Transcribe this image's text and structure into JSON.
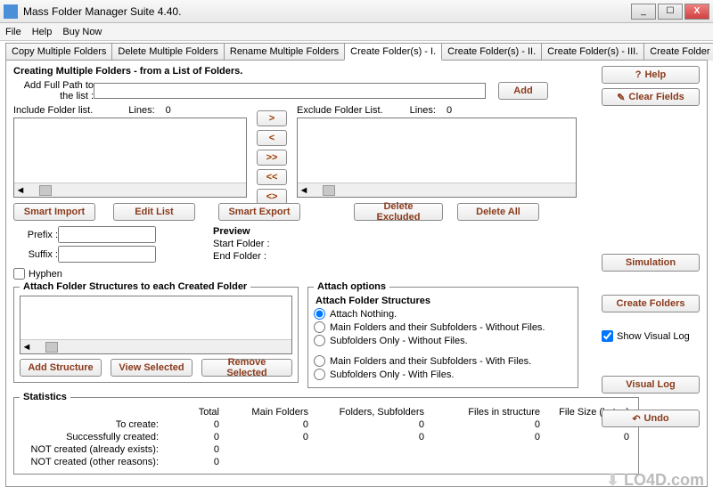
{
  "window": {
    "title": "Mass Folder Manager Suite 4.40."
  },
  "menu": {
    "file": "File",
    "help": "Help",
    "buy": "Buy Now"
  },
  "tabs": {
    "copy": "Copy Multiple Folders",
    "delete": "Delete Multiple Folders",
    "rename": "Rename Multiple Folders",
    "create1": "Create Folder(s)   - I.",
    "create2": "Create Folder(s)  - II.",
    "create3": "Create Folder(s)  - III.",
    "create4": "Create Folder -IV."
  },
  "header": {
    "title": "Creating Multiple Folders - from a List of Folders.",
    "pathLabel": "Add Full Path to\nthe list :",
    "pathValue": "",
    "add": "Add",
    "helpBtn": "Help",
    "clear": "Clear  Fields"
  },
  "lists": {
    "includeLabel": "Include Folder list.",
    "excludeLabel": "Exclude Folder List.",
    "linesLabel": "Lines:",
    "includeCount": "0",
    "excludeCount": "0"
  },
  "move": {
    "r": ">",
    "l": "<",
    "rr": ">>",
    "ll": "<<",
    "swap": "<>"
  },
  "listBtns": {
    "smartImport": "Smart Import",
    "editList": "Edit List",
    "smartExport": "Smart Export",
    "deleteExcluded": "Delete Excluded",
    "deleteAll": "Delete All"
  },
  "prefixSuffix": {
    "prefix": "Prefix :",
    "suffix": "Suffix :",
    "hyphen": "Hyphen"
  },
  "preview": {
    "label": "Preview",
    "start": "Start Folder :",
    "end": "End Folder :"
  },
  "attach": {
    "groupTitle": "Attach Folder Structures to each Created Folder",
    "addStructure": "Add Structure",
    "viewSelected": "View Selected",
    "removeSelected": "Remove Selected"
  },
  "options": {
    "groupTitle": "Attach options",
    "subTitle": "Attach Folder Structures",
    "r1": "Attach Nothing.",
    "r2": "Main Folders and their Subfolders - Without Files.",
    "r3": "Subfolders Only - Without Files.",
    "r4": "Main Folders and their Subfolders - With Files.",
    "r5": "Subfolders Only - With Files."
  },
  "right": {
    "simulation": "Simulation",
    "createFolders": "Create Folders",
    "showLog": "Show Visual Log",
    "visualLog": "Visual Log",
    "undo": "Undo"
  },
  "stats": {
    "title": "Statistics",
    "cols": {
      "total": "Total",
      "main": "Main Folders",
      "foldsub": "Folders, Subfolders",
      "files": "Files in structure",
      "size": "File Size (bytes)"
    },
    "rows": {
      "toCreate": {
        "label": "To create:",
        "c1": "0",
        "c2": "0",
        "c3": "0",
        "c4": "0",
        "c5": "0"
      },
      "succ": {
        "label": "Successfully created:",
        "c1": "0",
        "c2": "0",
        "c3": "0",
        "c4": "0",
        "c5": "0"
      },
      "exists": {
        "label": "NOT created (already exists):",
        "c1": "0"
      },
      "other": {
        "label": "NOT created (other reasons):",
        "c1": "0"
      }
    }
  },
  "watermark": "LO4D.com"
}
